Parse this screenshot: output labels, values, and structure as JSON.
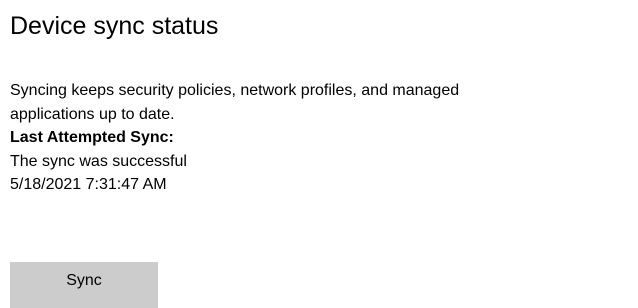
{
  "header": {
    "title": "Device sync status"
  },
  "description": {
    "line1": "Syncing keeps security policies, network profiles, and managed",
    "line2": "applications up to date."
  },
  "sync_info": {
    "label": "Last Attempted Sync:",
    "status": "The sync was successful",
    "timestamp": "5/18/2021 7:31:47 AM"
  },
  "actions": {
    "sync_label": "Sync"
  },
  "colors": {
    "background": "#ffffff",
    "button_background": "#cccccc",
    "text": "#000000"
  }
}
